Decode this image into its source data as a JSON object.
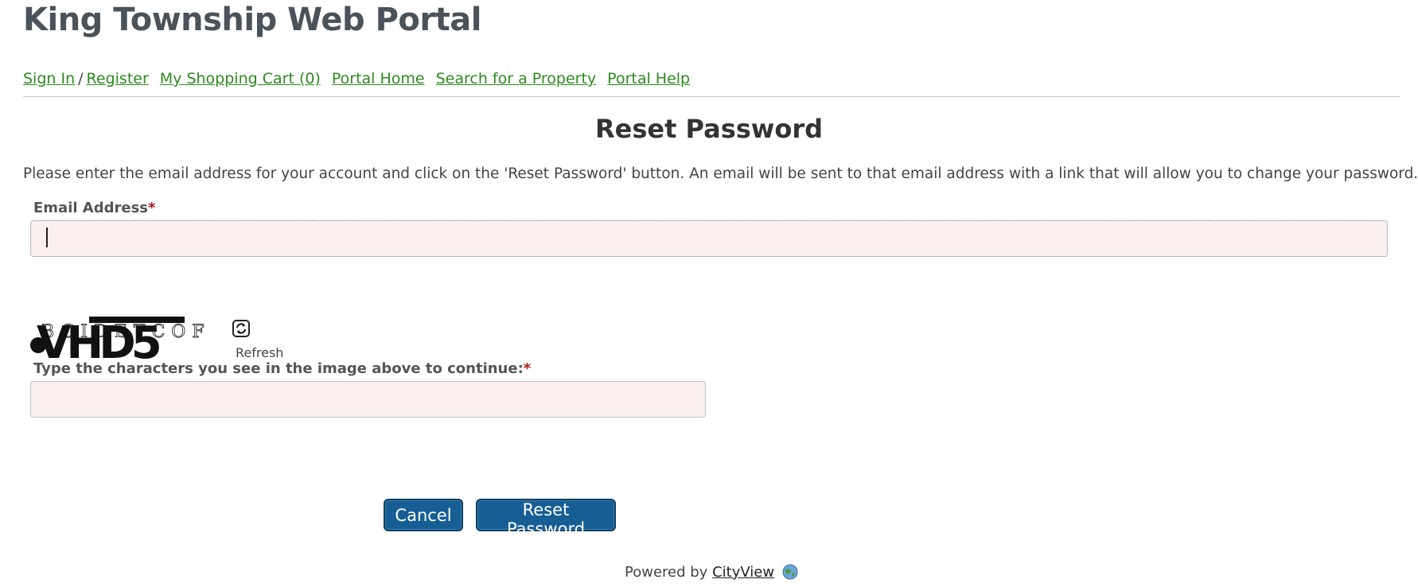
{
  "site": {
    "title": "King Township Web Portal"
  },
  "nav": {
    "sign_in": "Sign In",
    "separator": "/",
    "register": "Register",
    "cart": "My Shopping Cart (0)",
    "portal_home": "Portal Home",
    "search_property": "Search for a Property",
    "portal_help": "Portal Help"
  },
  "page": {
    "heading": "Reset Password",
    "intro": "Please enter the email address for your account and click on the 'Reset Password' button. An email will be sent to that email address with a link that will allow you to change your password."
  },
  "form": {
    "email_label": "Email Address",
    "required_mark": "*",
    "email_value": "",
    "captcha_text": "VHD5",
    "captcha_refresh_label": "Refresh",
    "captcha_label": "Type the characters you see in the image above to continue:",
    "captcha_value": ""
  },
  "buttons": {
    "cancel": "Cancel",
    "reset": "Reset Password"
  },
  "footer": {
    "powered_by": "Powered by",
    "brand": "CityView"
  },
  "icons": {
    "refresh": "refresh-icon",
    "globe": "globe-icon"
  },
  "colors": {
    "link": "#2d8a1e",
    "button": "#175e94",
    "field_background": "#fbeeee",
    "required": "#a51c1c",
    "title": "#4a525a"
  }
}
